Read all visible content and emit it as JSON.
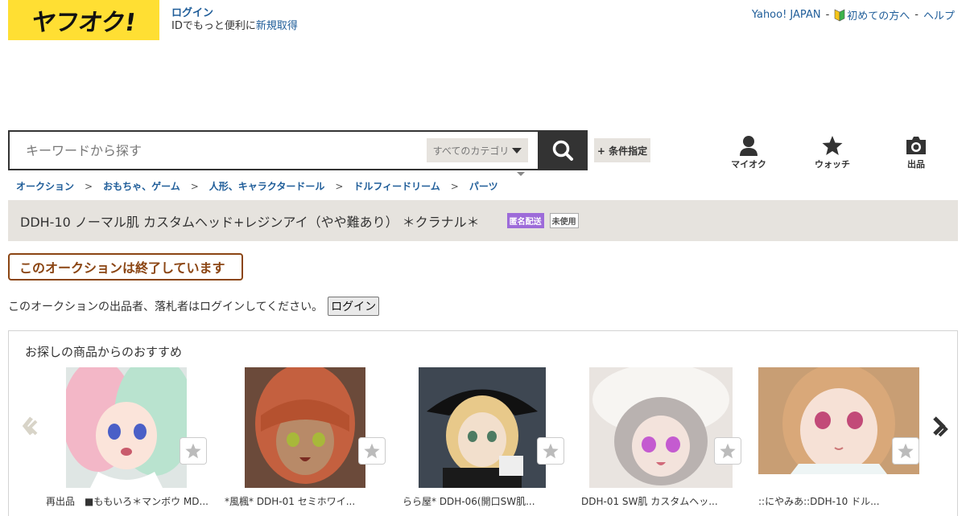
{
  "header": {
    "logo_text": "ヤフオク!",
    "login_label": "ログイン",
    "login_desc": "IDでもっと便利に",
    "signup_label": "新規取得",
    "links": {
      "yahoo": "Yahoo! JAPAN",
      "beginner": "初めての方へ",
      "help": "ヘルプ",
      "sep": "-"
    }
  },
  "search": {
    "placeholder": "キーワードから探す",
    "category": "すべてのカテゴリ",
    "condition_label": "+ 条件指定"
  },
  "quick_links": {
    "myauc": "マイオク",
    "watch": "ウォッチ",
    "sell": "出品"
  },
  "breadcrumb": [
    "オークション",
    "おもちゃ、ゲーム",
    "人形、キャラクタードール",
    "ドルフィードリーム",
    "パーツ"
  ],
  "breadcrumb_sep": ">",
  "item": {
    "title": "DDH-10 ノーマル肌 カスタムヘッド+レジンアイ（やや難あり） ＊クラナル＊",
    "badge_anonymous": "匿名配送",
    "badge_condition": "未使用"
  },
  "ended_label": "このオークションは終了しています",
  "notice_text": "このオークションの出品者、落札者はログインしてください。",
  "notice_button": "ログイン",
  "recommend": {
    "title": "お探しの商品からのおすすめ",
    "items": [
      {
        "title": "再出品　■ももいろ＊マンボウ MD..."
      },
      {
        "title": "*風楓* DDH-01 セミホワイ..."
      },
      {
        "title": "らら屋* DDH-06(開口SW肌..."
      },
      {
        "title": "DDH-01 SW肌 カスタムヘッ..."
      },
      {
        "title": "::にやみあ::DDH-10 ドル..."
      }
    ]
  },
  "colors": {
    "brand_yellow": "#ffdf33",
    "link": "#1f5d99",
    "ended": "#8b4513",
    "badge_purple": "#9d6bd9",
    "bar_bg": "#e6e3de"
  }
}
